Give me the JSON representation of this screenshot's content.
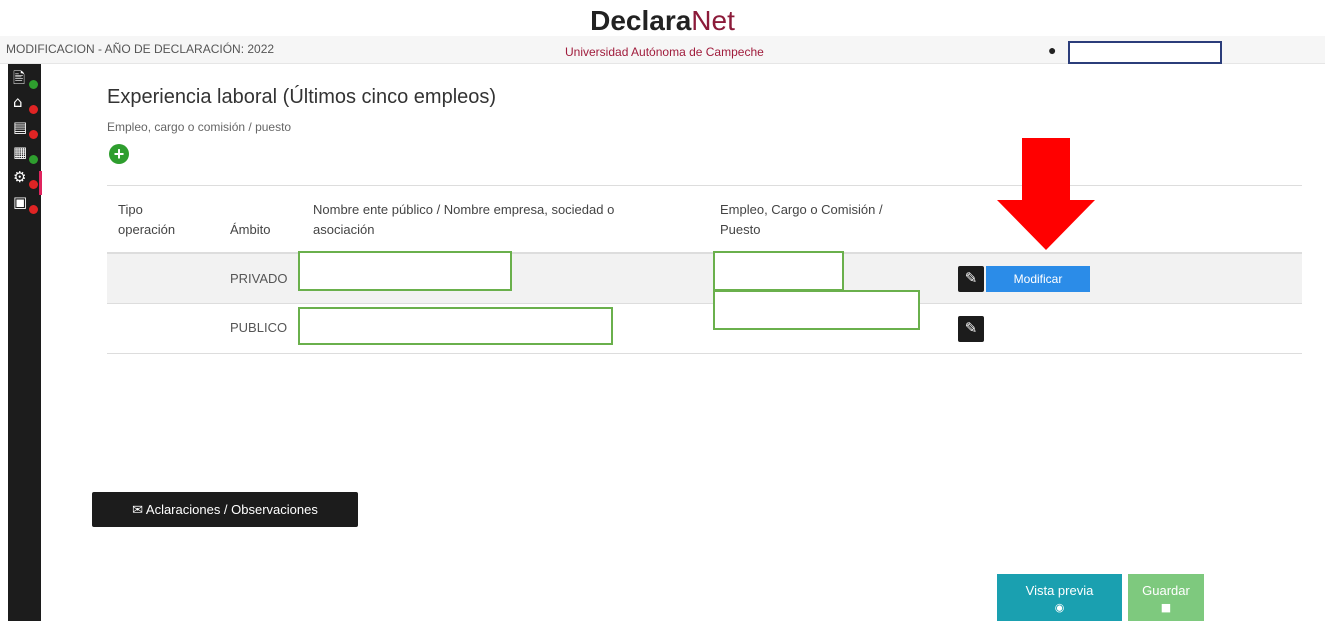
{
  "header": {
    "logo_bold": "Declara",
    "logo_light": "Net",
    "declaration": "MODIFICACION - AÑO DE DECLARACIÓN: 2022",
    "institution": "Universidad Autónoma de Campeche",
    "user_icon": "user-circle-icon"
  },
  "sidebar": {
    "items": [
      {
        "icon": "personal-data-icon",
        "status": "complete",
        "status_color": "#2e9e2e"
      },
      {
        "icon": "home-icon",
        "status": "incomplete",
        "status_color": "#e02424"
      },
      {
        "icon": "document-icon",
        "status": "incomplete",
        "status_color": "#e02424"
      },
      {
        "icon": "building-icon",
        "status": "complete",
        "status_color": "#2e9e2e"
      },
      {
        "icon": "work-experience-icon",
        "status": "incomplete",
        "status_color": "#e02424"
      },
      {
        "icon": "income-icon",
        "status": "incomplete",
        "status_color": "#e02424"
      }
    ]
  },
  "main": {
    "title": "Experiencia laboral (Últimos cinco empleos)",
    "subtitle": "Empleo, cargo o comisión / puesto",
    "add_icon": "plus-circle-icon",
    "table": {
      "headers": {
        "tipo": "Tipo operación",
        "ambito": "Ámbito",
        "nombre": "Nombre ente público / Nombre empresa, sociedad o asociación",
        "empleo": "Empleo, Cargo o Comisión / Puesto"
      },
      "rows": [
        {
          "tipo": "",
          "ambito": "PRIVADO",
          "nombre": "",
          "empleo": ""
        },
        {
          "tipo": "",
          "ambito": "PUBLICO",
          "nombre": "",
          "empleo": ""
        }
      ]
    },
    "modificar_label": "Modificar"
  },
  "footer": {
    "aclaraciones": "✉ Aclaraciones / Observaciones",
    "vista_previa": "Vista previa",
    "guardar": "Guardar"
  },
  "colors": {
    "accent_red": "#ff0000",
    "redaction_green": "#6ab04c",
    "teal": "#1aa0b0",
    "button_blue": "#2b8ce8"
  }
}
